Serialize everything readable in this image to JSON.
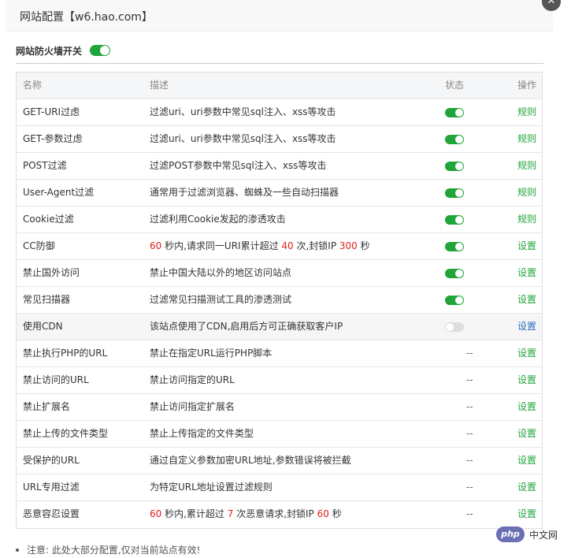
{
  "dialog": {
    "title": "网站配置【w6.hao.com】",
    "close_icon": "close-icon",
    "master_switch": {
      "label": "网站防火墙开关",
      "on": true
    }
  },
  "table": {
    "headers": {
      "name": "名称",
      "desc": "描述",
      "status": "状态",
      "op": "操作"
    },
    "rows": [
      {
        "name": "GET-URI过虑",
        "desc": "过滤uri、uri参数中常见sql注入、xss等攻击",
        "status": "on",
        "op": "规则"
      },
      {
        "name": "GET-参数过虑",
        "desc": "过滤uri、uri参数中常见sql注入、xss等攻击",
        "status": "on",
        "op": "规则"
      },
      {
        "name": "POST过滤",
        "desc": "过滤POST参数中常见sql注入、xss等攻击",
        "status": "on",
        "op": "规则"
      },
      {
        "name": "User-Agent过滤",
        "desc": "通常用于过滤浏览器、蜘蛛及一些自动扫描器",
        "status": "on",
        "op": "规则"
      },
      {
        "name": "Cookie过滤",
        "desc": "过滤利用Cookie发起的渗透攻击",
        "status": "on",
        "op": "规则"
      },
      {
        "name": "CC防御",
        "desc_parts": [
          {
            "text": "60",
            "red": true
          },
          {
            "text": " 秒内,请求同一URI累计超过 "
          },
          {
            "text": "40",
            "red": true
          },
          {
            "text": " 次,封锁IP "
          },
          {
            "text": "300",
            "red": true
          },
          {
            "text": " 秒"
          }
        ],
        "status": "on",
        "op": "设置"
      },
      {
        "name": "禁止国外访问",
        "desc": "禁止中国大陆以外的地区访问站点",
        "status": "on",
        "op": "设置"
      },
      {
        "name": "常见扫描器",
        "desc": "过滤常见扫描测试工具的渗透测试",
        "status": "on",
        "op": "设置"
      },
      {
        "name": "使用CDN",
        "desc": "该站点使用了CDN,启用后方可正确获取客户IP",
        "status": "off",
        "op": "设置"
      },
      {
        "name": "禁止执行PHP的URL",
        "desc": "禁止在指定URL运行PHP脚本",
        "status": "--",
        "op": "设置"
      },
      {
        "name": "禁止访问的URL",
        "desc": "禁止访问指定的URL",
        "status": "--",
        "op": "设置"
      },
      {
        "name": "禁止扩展名",
        "desc": "禁止访问指定扩展名",
        "status": "--",
        "op": "设置"
      },
      {
        "name": "禁止上传的文件类型",
        "desc": "禁止上传指定的文件类型",
        "status": "--",
        "op": "设置"
      },
      {
        "name": "受保护的URL",
        "desc": "通过自定义参数加密URL地址,参数错误将被拦截",
        "status": "--",
        "op": "设置"
      },
      {
        "name": "URL专用过滤",
        "desc": "为特定URL地址设置过滤规则",
        "status": "--",
        "op": "设置"
      },
      {
        "name": "恶意容忍设置",
        "desc_parts": [
          {
            "text": "60",
            "red": true
          },
          {
            "text": " 秒内,累计超过 "
          },
          {
            "text": "7",
            "red": true
          },
          {
            "text": " 次恶意请求,封锁IP "
          },
          {
            "text": "60",
            "red": true
          },
          {
            "text": " 秒"
          }
        ],
        "status": "--",
        "op": "设置"
      }
    ]
  },
  "note": "注意: 此处大部分配置,仅对当前站点有效!",
  "watermark": {
    "logo": "php",
    "text": "中文网"
  },
  "colors": {
    "accent": "#20a53a",
    "red": "#e02020",
    "link_blue": "#2c6fbd"
  }
}
